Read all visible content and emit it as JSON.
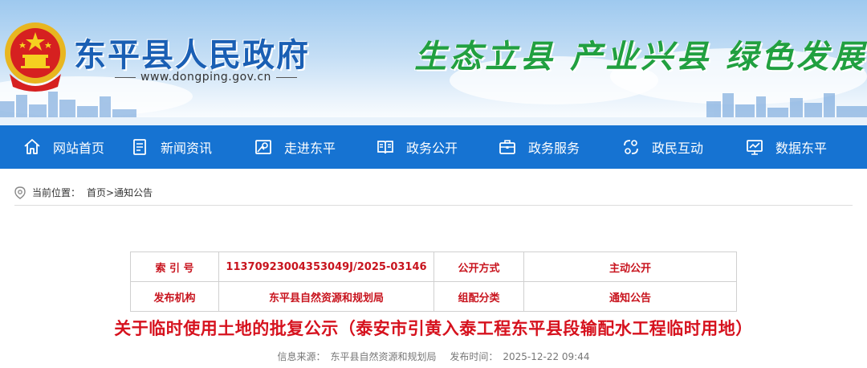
{
  "header": {
    "site_name": "东平县人民政府",
    "site_url": "www.dongping.gov.cn",
    "slogan": "生态立县 产业兴县 绿色发展",
    "brand_color": "#1a5fb4",
    "slogan_color": "#21a040"
  },
  "nav": {
    "bg_color": "#1673d2",
    "items": [
      {
        "label": "网站首页",
        "icon": "home-icon"
      },
      {
        "label": "新闻资讯",
        "icon": "news-icon"
      },
      {
        "label": "走进东平",
        "icon": "map-icon"
      },
      {
        "label": "政务公开",
        "icon": "book-icon"
      },
      {
        "label": "政务服务",
        "icon": "briefcase-icon"
      },
      {
        "label": "政民互动",
        "icon": "interact-icon"
      },
      {
        "label": "数据东平",
        "icon": "monitor-icon"
      }
    ]
  },
  "breadcrumb": {
    "prefix": "当前位置：",
    "home": "首页",
    "separator": ">",
    "current": "通知公告"
  },
  "info_table": {
    "index_label": "索 引 号",
    "index_value": "11370923004353049J/2025-03146",
    "mode_label": "公开方式",
    "mode_value": "主动公开",
    "org_label": "发布机构",
    "org_value": "东平县自然资源和规划局",
    "category_label": "组配分类",
    "category_value": "通知公告"
  },
  "article": {
    "title": "关于临时使用土地的批复公示（泰安市引黄入泰工程东平县段输配水工程临时用地）",
    "title_color": "#d6121e",
    "source_label": "信息来源：",
    "source_value": "东平县自然资源和规划局",
    "date_label": "发布时间：",
    "date_value": "2025-12-22 09:44"
  }
}
